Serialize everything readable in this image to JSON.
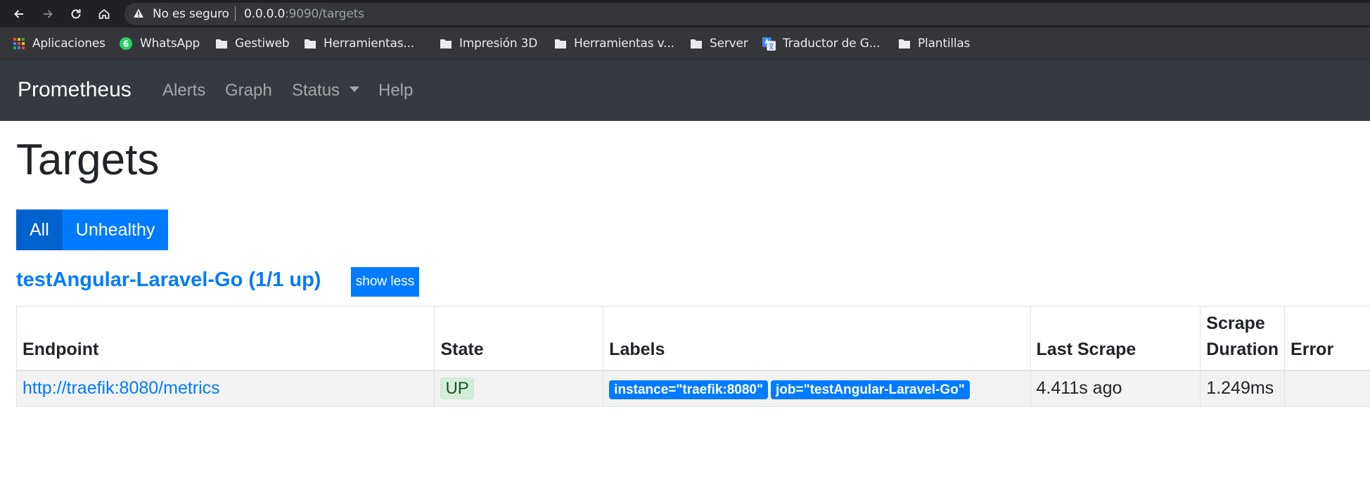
{
  "browser": {
    "security_label": "No es seguro",
    "url_host": "0.0.0.0",
    "url_path": ":9090/targets"
  },
  "bookmarks": [
    {
      "label": "Aplicaciones",
      "icon": "apps-grid-icon"
    },
    {
      "label": "WhatsApp",
      "icon": "whatsapp-icon",
      "badge": "6"
    },
    {
      "label": "Gestiweb",
      "icon": "folder-icon"
    },
    {
      "label": "Herramientas...",
      "icon": "folder-icon"
    },
    {
      "label": "Impresión 3D",
      "icon": "folder-icon"
    },
    {
      "label": "Herramientas v...",
      "icon": "folder-icon"
    },
    {
      "label": "Server",
      "icon": "folder-icon"
    },
    {
      "label": "Traductor de G...",
      "icon": "google-translate-icon"
    },
    {
      "label": "Plantillas",
      "icon": "folder-icon"
    }
  ],
  "navbar": {
    "brand": "Prometheus",
    "links": [
      "Alerts",
      "Graph",
      "Status",
      "Help"
    ]
  },
  "page": {
    "title": "Targets",
    "filters": {
      "all": "All",
      "unhealthy": "Unhealthy",
      "active": "All"
    }
  },
  "job": {
    "title": "testAngular-Laravel-Go (1/1 up)",
    "toggle_label": "show less"
  },
  "table": {
    "headers": {
      "endpoint": "Endpoint",
      "state": "State",
      "labels": "Labels",
      "last_scrape": "Last Scrape",
      "scrape_duration": "Scrape Duration",
      "error": "Error"
    },
    "rows": [
      {
        "endpoint": "http://traefik:8080/metrics",
        "state": "UP",
        "labels": [
          "instance=\"traefik:8080\"",
          "job=\"testAngular-Laravel-Go\""
        ],
        "last_scrape": "4.411s ago",
        "scrape_duration": "1.249ms",
        "error": ""
      }
    ]
  },
  "colors": {
    "navbar_bg": "#343a40",
    "primary": "#007bff",
    "primary_active": "#0062cc",
    "success_bg": "#d4edda",
    "success_text": "#155724"
  }
}
